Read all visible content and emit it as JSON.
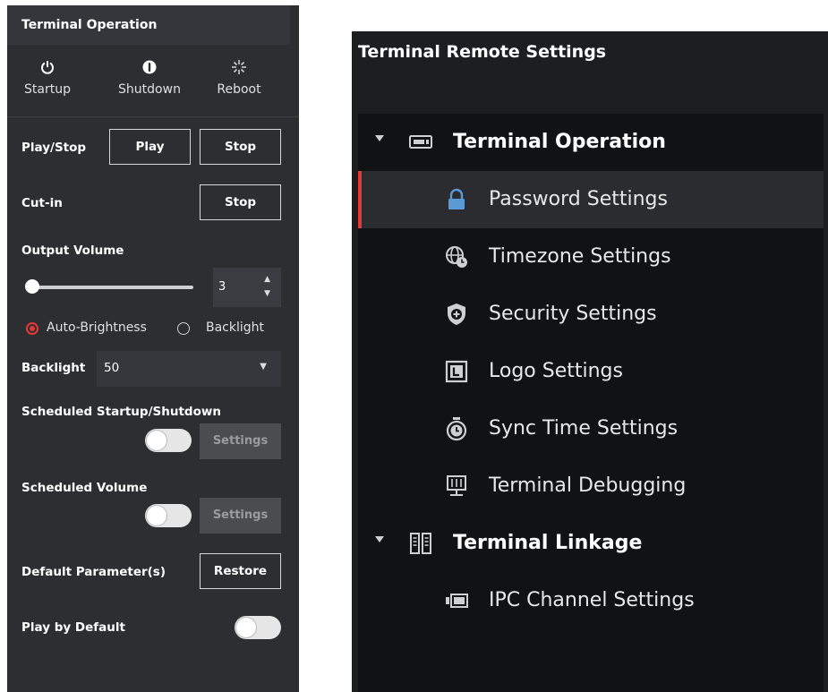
{
  "left_panel": {
    "title": "Terminal Operation",
    "power": {
      "startup": "Startup",
      "shutdown": "Shutdown",
      "reboot": "Reboot"
    },
    "play_stop": {
      "label": "Play/Stop",
      "play": "Play",
      "stop": "Stop"
    },
    "cut_in": {
      "label": "Cut-in",
      "stop": "Stop"
    },
    "output_volume": {
      "label": "Output Volume",
      "value": "3",
      "level": 0
    },
    "brightness": {
      "auto": "Auto-Brightness",
      "backlight": "Backlight",
      "selected": "auto"
    },
    "backlight": {
      "label": "Backlight",
      "value": "50"
    },
    "scheduled_startup": {
      "label": "Scheduled Startup/Shutdown",
      "settings": "Settings",
      "enabled": false
    },
    "scheduled_volume": {
      "label": "Scheduled Volume",
      "settings": "Settings",
      "enabled": false
    },
    "default_params": {
      "label": "Default Parameter(s)",
      "restore": "Restore"
    },
    "play_default": {
      "label": "Play by Default",
      "enabled": false
    }
  },
  "right_panel": {
    "title": "Terminal Remote Settings",
    "groups": [
      {
        "label": "Terminal Operation",
        "icon": "monitor-icon",
        "items": [
          {
            "label": "Password Settings",
            "icon": "lock-icon",
            "selected": true
          },
          {
            "label": "Timezone Settings",
            "icon": "globe-clock-icon"
          },
          {
            "label": "Security Settings",
            "icon": "shield-icon"
          },
          {
            "label": "Logo Settings",
            "icon": "logo-icon"
          },
          {
            "label": "Sync Time Settings",
            "icon": "stopwatch-icon"
          },
          {
            "label": "Terminal Debugging",
            "icon": "debug-icon"
          }
        ]
      },
      {
        "label": "Terminal Linkage",
        "icon": "linkage-icon",
        "items": [
          {
            "label": "IPC Channel Settings",
            "icon": "camera-icon"
          }
        ]
      }
    ]
  },
  "colors": {
    "accent_red": "#e53935",
    "panel_bg": "#2c2e32",
    "tree_bg": "#111213"
  }
}
